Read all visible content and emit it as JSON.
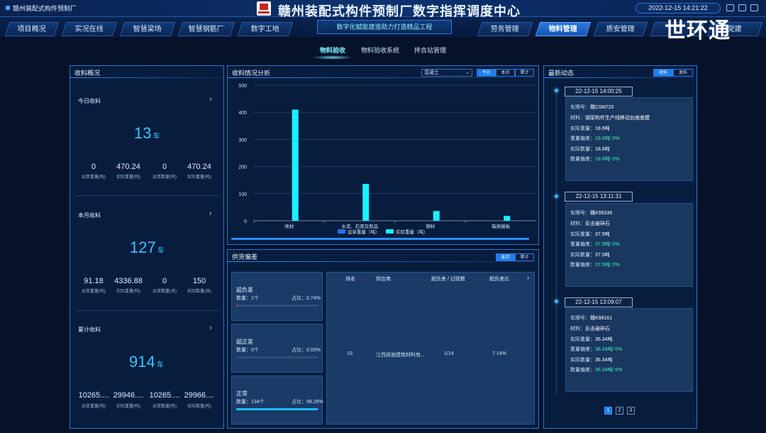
{
  "header": {
    "company": "赣州装配式构件预制厂",
    "title": "赣州装配式构件预制厂数字指挥调度中心",
    "datetime": "2022-12-15 14:21:22",
    "slogan": "数字化赋能建造助力打造精品工程",
    "brand": "世环通",
    "nav_left": [
      "项目概况",
      "实况在线",
      "智慧梁场",
      "智慧钢筋厂",
      "数字工地"
    ],
    "nav_right": [
      "劳务管理",
      "物料管理",
      "质安管理",
      "",
      "党建"
    ],
    "nav_active": "物料管理"
  },
  "subtabs": [
    "物料验收",
    "物料验收系统",
    "拌合站管理"
  ],
  "left": {
    "title": "收料概况",
    "sections": [
      {
        "label": "今日收料",
        "count": "13",
        "unit": "车",
        "cells": [
          {
            "value": "0",
            "label": "运单重量(吨)"
          },
          {
            "value": "470.24",
            "label": "实际重量(吨)"
          },
          {
            "value": "0",
            "label": "运单数量(吨)"
          },
          {
            "value": "470.24",
            "label": "实际重量(吨)"
          }
        ]
      },
      {
        "label": "本月收料",
        "count": "127",
        "unit": "车",
        "cells": [
          {
            "value": "91.18",
            "label": "运单重量(吨)"
          },
          {
            "value": "4336.88",
            "label": "实际重量(吨)"
          },
          {
            "value": "0",
            "label": "运单数量(块)"
          },
          {
            "value": "150",
            "label": "实际数量(块)"
          }
        ]
      },
      {
        "label": "累计收料",
        "count": "914",
        "unit": "车",
        "cells": [
          {
            "value": "10265....",
            "label": "运单重量(吨)"
          },
          {
            "value": "29946....",
            "label": "实际重量(吨)"
          },
          {
            "value": "10265....",
            "label": "运单数量(吨)"
          },
          {
            "value": "29966....",
            "label": "实际数量(吨)"
          }
        ]
      }
    ]
  },
  "chart_panel": {
    "title": "收料情况分析",
    "select_value": "混凝土",
    "range_tabs": [
      "今日",
      "本月",
      "累计"
    ],
    "range_active": "今日"
  },
  "chart_data": {
    "type": "bar",
    "categories": [
      "地材",
      "水泥、石膏及制品",
      "钢材",
      "箱梁模板"
    ],
    "series": [
      {
        "name": "运单重量（吨）",
        "values": [
          0,
          0,
          0,
          0
        ],
        "color": "#2a6ff0"
      },
      {
        "name": "实际重量（吨）",
        "values": [
          410,
          136,
          36,
          18
        ],
        "color": "#19f0ff"
      }
    ],
    "ylim": [
      0,
      500
    ],
    "yticks": [
      0,
      100,
      200,
      300,
      400,
      500
    ],
    "grid": true,
    "legend": "bottom"
  },
  "supply": {
    "title": "供货偏差",
    "tabs": [
      "本月",
      "累计"
    ],
    "tab_active": "本月",
    "cards": [
      {
        "name": "超负差",
        "count_label": "数量：",
        "count": "1个",
        "ratio_label": "占比：",
        "ratio": "0.74%",
        "fill": 0.0074,
        "color": "#e0465a"
      },
      {
        "name": "超正差",
        "count_label": "数量：",
        "count": "0个",
        "ratio_label": "占比：",
        "ratio": "0.00%",
        "fill": 0.0,
        "color": "#3df0b8"
      },
      {
        "name": "正常",
        "count_label": "数量：",
        "count": "134个",
        "ratio_label": "占比：",
        "ratio": "99.26%",
        "fill": 0.9926,
        "color": "#19c0ff"
      }
    ],
    "table_headers": [
      "排名",
      "供应商",
      "超负差 / 过磅数",
      "超负差比"
    ],
    "rows": [
      {
        "rank": "01",
        "supplier": "江西凯驰建筑材料有...",
        "ratio": "1/14",
        "percent": "7.14%"
      }
    ]
  },
  "right": {
    "title": "最新动态",
    "tabs": [
      "收料",
      "发料"
    ],
    "tab_active": "收料",
    "events": [
      {
        "time": "22-12-15 14:00:25",
        "plate_label": "车牌号：",
        "plate": "赣C0M720",
        "material_label": "材料：",
        "material": "钢梁构件生产线移动台座底模",
        "weight_label": "实际重量：",
        "weight": "18.6吨",
        "dev_label": "重量偏差：",
        "dev": "18.6吨/ 0%",
        "qty_label": "实际数量：",
        "qty": "18.6吨",
        "qdev_label": "数量偏差：",
        "qdev": "18.6吨/ 0%"
      },
      {
        "time": "22-12-15 13:11:31",
        "plate_label": "车牌号：",
        "plate": "赣K99339",
        "material_label": "材料：",
        "material": "反击破碎石",
        "weight_label": "实际重量：",
        "weight": "37.5吨",
        "dev_label": "重量偏差：",
        "dev": "37.5吨/ 0%",
        "qty_label": "实际数量：",
        "qty": "37.5吨",
        "qdev_label": "数量偏差：",
        "qdev": "37.5吨/ 0%"
      },
      {
        "time": "22-12-15 13:09:07",
        "plate_label": "车牌号：",
        "plate": "赣K98161",
        "material_label": "材料：",
        "material": "反击破碎石",
        "weight_label": "实际重量：",
        "weight": "36.34吨",
        "dev_label": "重量偏差：",
        "dev": "36.34吨/ 0%",
        "qty_label": "实际数量：",
        "qty": "36.34吨",
        "qdev_label": "数量偏差：",
        "qdev": "36.34吨/ 0%"
      }
    ],
    "pages": [
      "1",
      "2",
      "3"
    ],
    "page_active": "1"
  }
}
